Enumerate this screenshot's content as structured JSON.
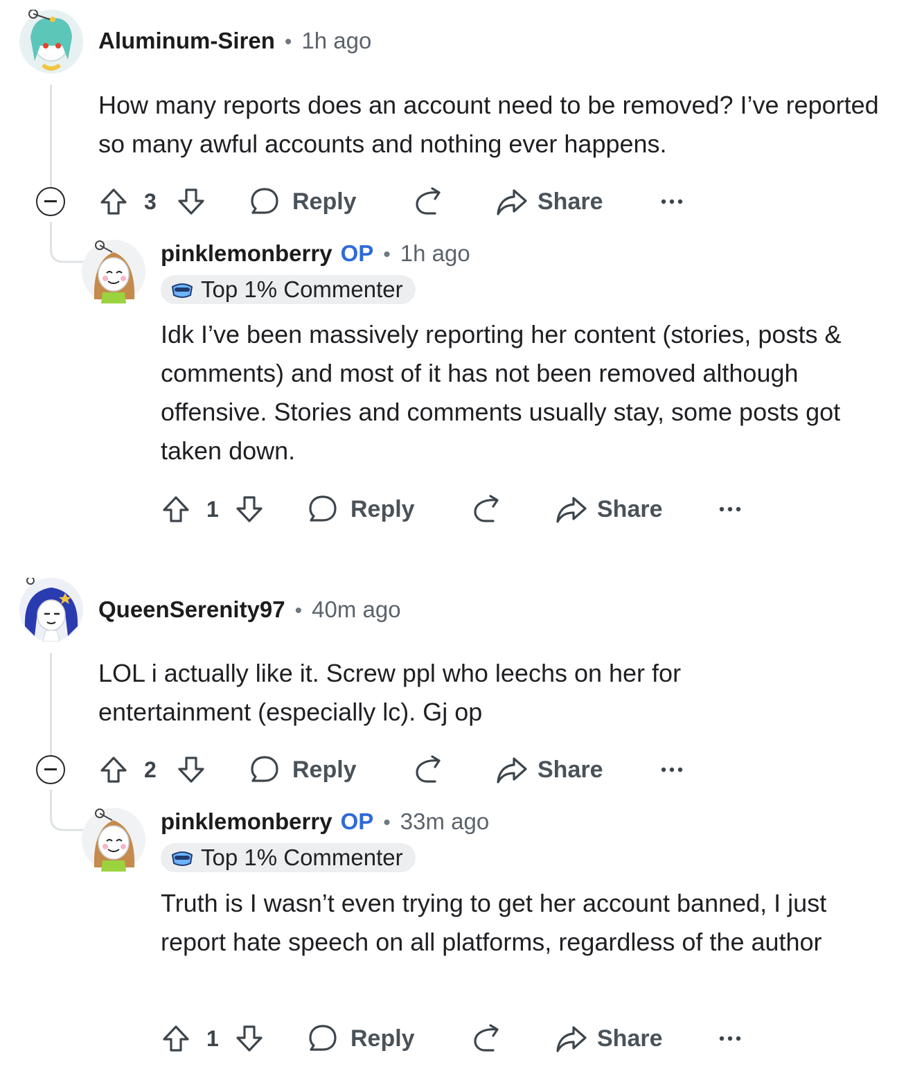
{
  "comments": [
    {
      "username": "Aluminum-Siren",
      "time": "1h ago",
      "text": "How many reports does an account need to be removed? I’ve reported so many awful accounts and nothing ever happens.",
      "votes": "3",
      "reply": "Reply",
      "share": "Share",
      "reply_item": {
        "username": "pinklemonberry",
        "op": "OP",
        "time": "1h ago",
        "flair": "Top 1% Commenter",
        "text": "Idk I’ve been massively reporting her content (stories, posts & comments) and most of it has not been removed although offensive. Stories and comments usually stay, some posts got taken down.",
        "votes": "1",
        "reply": "Reply",
        "share": "Share"
      }
    },
    {
      "username": "QueenSerenity97",
      "time": "40m ago",
      "text": "LOL i actually like it. Screw ppl who leechs on her for entertainment (especially lc). Gj op",
      "votes": "2",
      "reply": "Reply",
      "share": "Share",
      "reply_item": {
        "username": "pinklemonberry",
        "op": "OP",
        "time": "33m ago",
        "flair": "Top 1% Commenter",
        "text": "Truth is I wasn’t even trying to get her account banned, I just report hate speech on all platforms, regardless of the author",
        "votes": "1",
        "reply": "Reply",
        "share": "Share"
      }
    }
  ],
  "icons": [
    "upvote-icon",
    "downvote-icon",
    "comment-icon",
    "award-icon",
    "share-icon",
    "more-icon",
    "collapse-icon"
  ],
  "colors": {
    "op": "#2f6ad8",
    "text": "#1c1c1c",
    "muted": "#5b636b",
    "thread": "#dfe3e6"
  }
}
